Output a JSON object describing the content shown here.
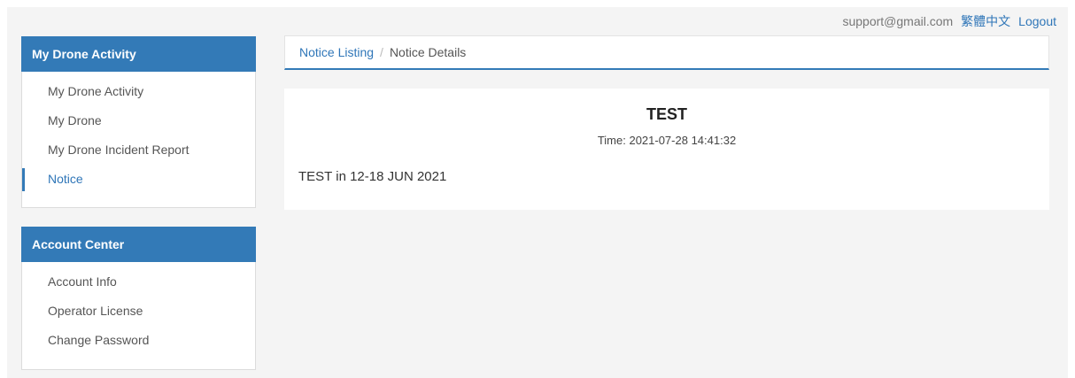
{
  "header": {
    "email": "support@gmail.com",
    "language_link": "繁體中文",
    "logout_link": "Logout"
  },
  "sidebar": {
    "activity_panel": {
      "title": "My Drone Activity",
      "items": [
        {
          "label": "My Drone Activity"
        },
        {
          "label": "My Drone"
        },
        {
          "label": "My Drone Incident Report"
        },
        {
          "label": "Notice",
          "active": true
        }
      ]
    },
    "account_panel": {
      "title": "Account Center",
      "items": [
        {
          "label": "Account Info"
        },
        {
          "label": "Operator License"
        },
        {
          "label": "Change Password"
        }
      ]
    }
  },
  "breadcrumb": {
    "parent": "Notice Listing",
    "separator": "/",
    "current": "Notice Details"
  },
  "notice": {
    "title": "TEST",
    "time": "Time: 2021-07-28 14:41:32",
    "body": "TEST in 12-18 JUN 2021"
  },
  "colors": {
    "accent": "#337ab7",
    "link": "#2f76b8",
    "background": "#f4f4f4"
  }
}
